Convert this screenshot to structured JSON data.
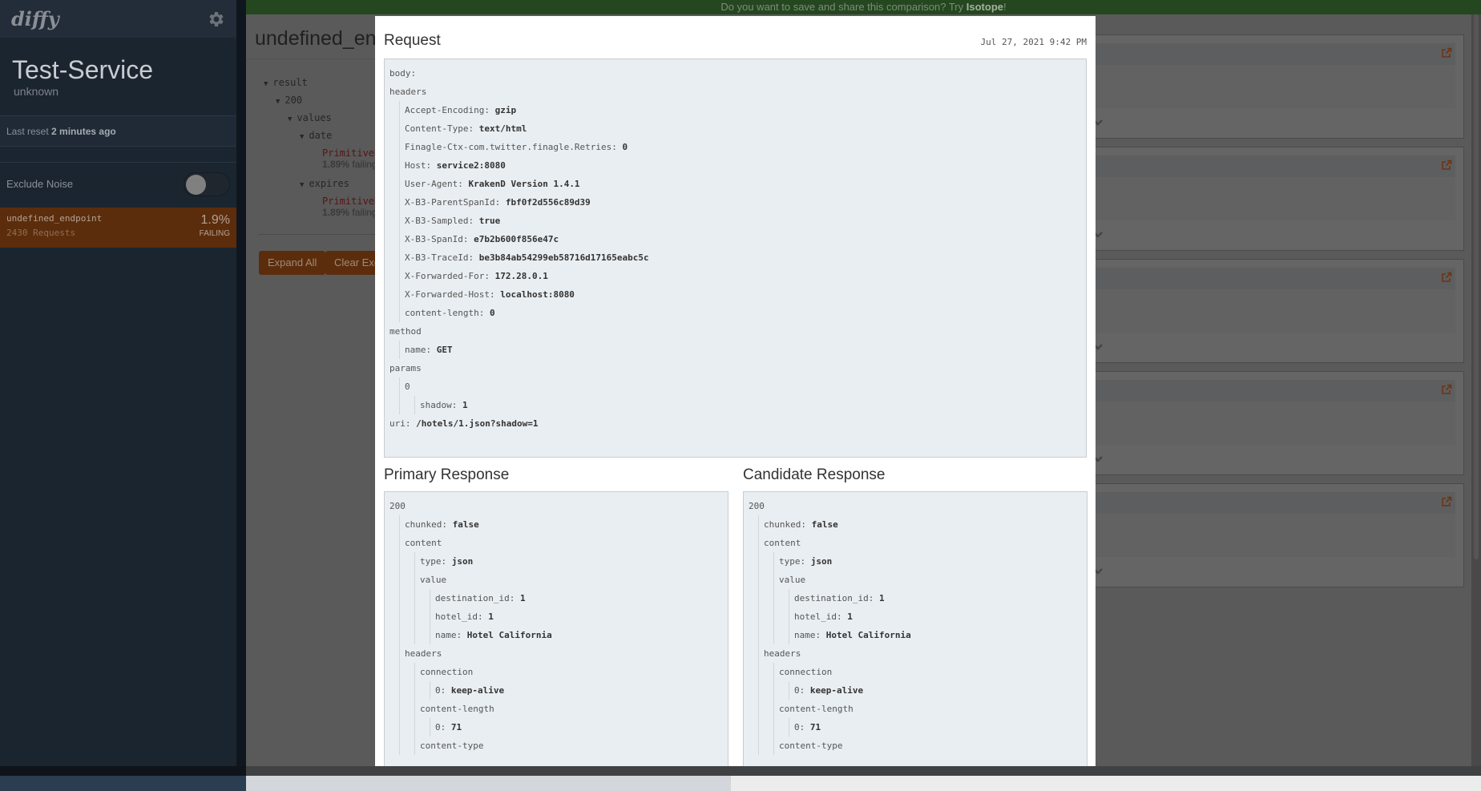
{
  "sidebar": {
    "logo": "diffy",
    "service_name": "Test-Service",
    "service_env": "unknown",
    "last_reset_label": "Last reset",
    "last_reset_value": "2 minutes ago",
    "exclude_noise_label": "Exclude Noise",
    "exclude_noise_on": false,
    "endpoints": [
      {
        "name": "undefined_endpoint",
        "requests": "2430 Requests",
        "percent": "1.9%",
        "status": "FAILING"
      }
    ]
  },
  "banner": {
    "text": "Do you want to save and share this comparison? Try ",
    "link": "Isotope",
    "suffix": "!"
  },
  "main": {
    "title": "undefined_end",
    "tree": [
      {
        "label": "result"
      },
      {
        "label": "200"
      },
      {
        "label": "values"
      },
      {
        "label": "date"
      },
      {
        "diff": "PrimitiveD",
        "pct": "1.89%",
        "suffix": " failing"
      },
      {
        "label": "expires"
      },
      {
        "diff": "PrimitiveD",
        "pct": "1.89%",
        "suffix": " failing"
      }
    ],
    "expand_all": "Expand All",
    "clear_exclusions": "Clear Exc",
    "cards_count": 5
  },
  "modal": {
    "request_title": "Request",
    "timestamp": "Jul 27, 2021 9:42 PM",
    "request": {
      "body_label": "body:",
      "headers_label": "headers",
      "headers": [
        {
          "k": "Accept-Encoding",
          "v": "gzip"
        },
        {
          "k": "Content-Type",
          "v": "text/html"
        },
        {
          "k": "Finagle-Ctx-com.twitter.finagle.Retries",
          "v": "0"
        },
        {
          "k": "Host",
          "v": "service2:8080"
        },
        {
          "k": "User-Agent",
          "v": "KrakenD Version 1.4.1"
        },
        {
          "k": "X-B3-ParentSpanId",
          "v": "fbf0f2d556c89d39"
        },
        {
          "k": "X-B3-Sampled",
          "v": "true"
        },
        {
          "k": "X-B3-SpanId",
          "v": "e7b2b600f856e47c"
        },
        {
          "k": "X-B3-TraceId",
          "v": "be3b84ab54299eb58716d17165eabc5c"
        },
        {
          "k": "X-Forwarded-For",
          "v": "172.28.0.1"
        },
        {
          "k": "X-Forwarded-Host",
          "v": "localhost:8080"
        },
        {
          "k": "content-length",
          "v": "0"
        }
      ],
      "method_label": "method",
      "method_name_key": "name",
      "method_name": "GET",
      "params_label": "params",
      "params_index": "0",
      "param_key": "shadow",
      "param_value": "1",
      "uri_key": "uri",
      "uri": "/hotels/1.json?shadow=1"
    },
    "primary": {
      "title": "Primary Response",
      "status": "200",
      "chunked": "false",
      "content_type": "json",
      "destination_id": "1",
      "hotel_id": "1",
      "name": "Hotel California",
      "connection": "keep-alive",
      "content_length": "71"
    },
    "candidate": {
      "title": "Candidate Response",
      "status": "200",
      "chunked": "false",
      "content_type": "json",
      "destination_id": "1",
      "hotel_id": "1",
      "name": "Hotel California",
      "connection": "keep-alive",
      "content_length": "71"
    },
    "labels": {
      "chunked": "chunked",
      "content": "content",
      "type": "type",
      "value": "value",
      "destination_id": "destination_id",
      "hotel_id": "hotel_id",
      "name": "name",
      "headers": "headers",
      "connection": "connection",
      "content_length": "content-length",
      "content_type": "content-type",
      "idx0": "0"
    }
  }
}
